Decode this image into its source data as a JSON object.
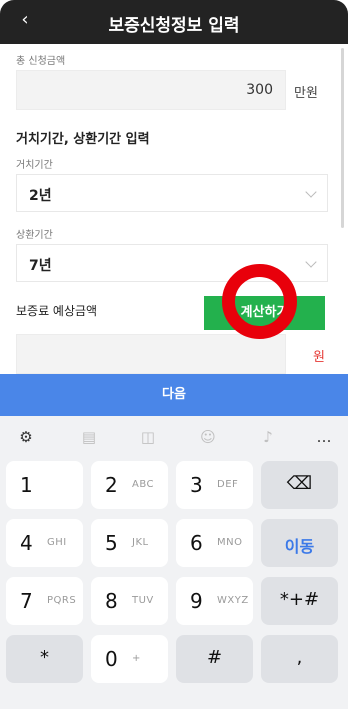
{
  "header": {
    "title": "보증신청정보 입력",
    "back_icon": "‹"
  },
  "form": {
    "total_amount_label": "총 신청금액",
    "total_amount_value": "300",
    "total_amount_unit": "만원",
    "period_section": "거치기간, 상환기간 입력",
    "grace_label": "거치기간",
    "grace_value": "2년",
    "repay_label": "상환기간",
    "repay_value": "7년",
    "fee_label": "보증료 예상금액",
    "calc_button": "계산하기",
    "fee_unit": "원"
  },
  "next_button": "다음",
  "keyboard": {
    "tools": [
      "gear-icon",
      "clipboard-icon",
      "sticker-icon",
      "emoji-icon",
      "mic-icon",
      "more-icon"
    ],
    "keys": [
      {
        "main": "1",
        "sub": ""
      },
      {
        "main": "2",
        "sub": "ABC"
      },
      {
        "main": "3",
        "sub": "DEF"
      },
      {
        "main": "⌫",
        "sub": ""
      },
      {
        "main": "4",
        "sub": "GHI"
      },
      {
        "main": "5",
        "sub": "JKL"
      },
      {
        "main": "6",
        "sub": "MNO"
      },
      {
        "main": "이동",
        "sub": ""
      },
      {
        "main": "7",
        "sub": "PQRS"
      },
      {
        "main": "8",
        "sub": "TUV"
      },
      {
        "main": "9",
        "sub": "WXYZ"
      },
      {
        "main": "*+#",
        "sub": ""
      },
      {
        "main": "*",
        "sub": ""
      },
      {
        "main": "0",
        "sub": "+"
      },
      {
        "main": "#",
        "sub": ""
      },
      {
        "main": ",",
        "sub": ""
      }
    ]
  },
  "colors": {
    "header": "#232323",
    "next": "#4a86e8",
    "calc": "#23b14d",
    "annotation": "#e8000b",
    "accent_blue": "#3b79e8"
  }
}
